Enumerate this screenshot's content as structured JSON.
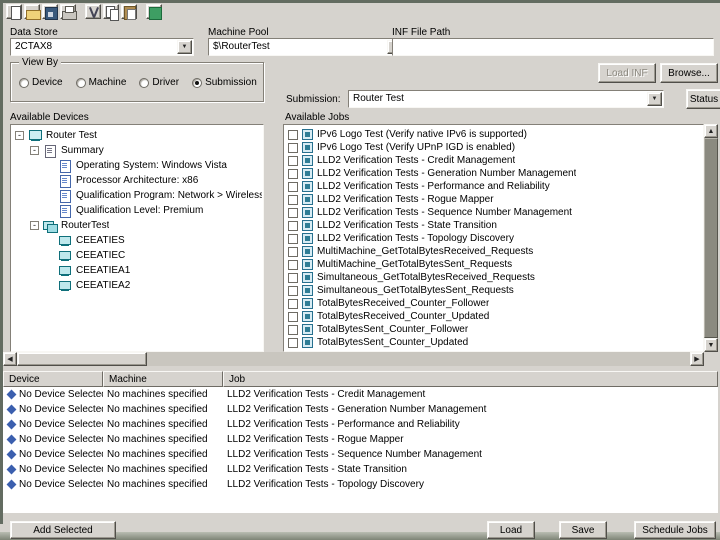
{
  "toolbar": {
    "icons": [
      "new-document",
      "open-folder",
      "save",
      "print",
      "cut",
      "copy",
      "paste",
      "run"
    ]
  },
  "header": {
    "data_store": {
      "label": "Data Store",
      "value": "2CTAX8"
    },
    "machine_pool": {
      "label": "Machine Pool",
      "value": "$\\RouterTest"
    },
    "inf_path": {
      "label": "INF File Path",
      "value": ""
    }
  },
  "view_by": {
    "label": "View By",
    "options": [
      "Device",
      "Machine",
      "Driver",
      "Submission"
    ],
    "selected": "Submission"
  },
  "actions": {
    "load_inf": "Load INF",
    "browse": "Browse...",
    "status": "Status"
  },
  "submission": {
    "label": "Submission:",
    "value": "Router Test"
  },
  "devices_panel": {
    "label": "Available Devices",
    "tree": [
      {
        "label": "Router Test",
        "level": 0,
        "icon": "computer",
        "expandable": true
      },
      {
        "label": "Summary",
        "level": 1,
        "icon": "summary",
        "expandable": true
      },
      {
        "label": "Operating System: Windows Vista",
        "level": 2,
        "icon": "page"
      },
      {
        "label": "Processor Architecture: x86",
        "level": 2,
        "icon": "page"
      },
      {
        "label": "Qualification Program: Network > Wireless Router",
        "level": 2,
        "icon": "page"
      },
      {
        "label": "Qualification Level: Premium",
        "level": 2,
        "icon": "page"
      },
      {
        "label": "RouterTest",
        "level": 1,
        "icon": "machine-group",
        "expandable": true
      },
      {
        "label": "CEEATIES",
        "level": 2,
        "icon": "machine"
      },
      {
        "label": "CEEATIEC",
        "level": 2,
        "icon": "machine"
      },
      {
        "label": "CEEATIEA1",
        "level": 2,
        "icon": "machine"
      },
      {
        "label": "CEEATIEA2",
        "level": 2,
        "icon": "machine"
      }
    ]
  },
  "jobs_panel": {
    "label": "Available Jobs",
    "jobs": [
      "IPv6 Logo Test (Verify native IPv6 is supported)",
      "IPv6 Logo Test (Verify UPnP IGD is enabled)",
      "LLD2 Verification Tests - Credit Management",
      "LLD2 Verification Tests - Generation Number Management",
      "LLD2 Verification Tests - Performance and Reliability",
      "LLD2 Verification Tests - Rogue Mapper",
      "LLD2 Verification Tests - Sequence Number Management",
      "LLD2 Verification Tests - State Transition",
      "LLD2 Verification Tests - Topology Discovery",
      "MultiMachine_GetTotalBytesReceived_Requests",
      "MultiMachine_GetTotalBytesSent_Requests",
      "Simultaneous_GetTotalBytesReceived_Requests",
      "Simultaneous_GetTotalBytesSent_Requests",
      "TotalBytesReceived_Counter_Follower",
      "TotalBytesReceived_Counter_Updated",
      "TotalBytesSent_Counter_Follower",
      "TotalBytesSent_Counter_Updated"
    ]
  },
  "grid": {
    "columns": [
      "Device",
      "Machine",
      "Job"
    ],
    "rows": [
      [
        "No Device Selected",
        "No machines specified",
        "LLD2 Verification Tests - Credit Management"
      ],
      [
        "No Device Selected",
        "No machines specified",
        "LLD2 Verification Tests - Generation Number Management"
      ],
      [
        "No Device Selected",
        "No machines specified",
        "LLD2 Verification Tests - Performance and Reliability"
      ],
      [
        "No Device Selected",
        "No machines specified",
        "LLD2 Verification Tests - Rogue Mapper"
      ],
      [
        "No Device Selected",
        "No machines specified",
        "LLD2 Verification Tests - Sequence Number Management"
      ],
      [
        "No Device Selected",
        "No machines specified",
        "LLD2 Verification Tests - State Transition"
      ],
      [
        "No Device Selected",
        "No machines specified",
        "LLD2 Verification Tests - Topology Discovery"
      ]
    ]
  },
  "footer": {
    "add_selected": "Add Selected",
    "load": "Load",
    "save": "Save",
    "schedule_jobs": "Schedule Jobs"
  },
  "colors": {
    "background": "#d6d3ce",
    "panel": "#ffffff",
    "accent_teal": "#2f7d95",
    "accent_blue": "#3b5fae"
  }
}
